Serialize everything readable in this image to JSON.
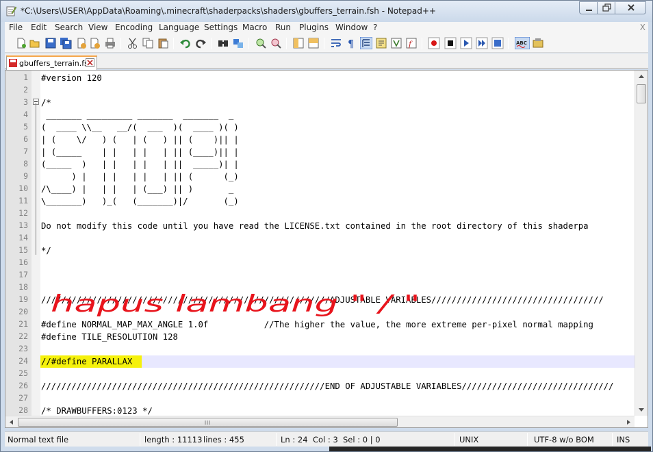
{
  "window": {
    "title": "*C:\\Users\\USER\\AppData\\Roaming\\.minecraft\\shaderpacks\\shaders\\gbuffers_terrain.fsh - Notepad++"
  },
  "menu": {
    "items": [
      "File",
      "Edit",
      "Search",
      "View",
      "Encoding",
      "Language",
      "Settings",
      "Macro",
      "Run",
      "Plugins",
      "Window",
      "?"
    ],
    "close_label": "X"
  },
  "toolbar": {
    "icons": [
      "new-file-icon",
      "open-file-icon",
      "save-icon",
      "save-all-icon",
      "close-icon",
      "close-all-icon",
      "print-icon",
      "cut-icon",
      "copy-icon",
      "paste-icon",
      "undo-icon",
      "redo-icon",
      "find-icon",
      "replace-icon",
      "zoom-in-icon",
      "zoom-out-icon",
      "sync-vertical-icon",
      "sync-horizontal-icon",
      "word-wrap-icon",
      "show-all-chars-icon",
      "indent-guide-icon",
      "user-language-icon",
      "document-map-icon",
      "function-list-icon",
      "record-macro-icon",
      "stop-macro-icon",
      "play-macro-icon",
      "run-macro-multiple-icon",
      "save-macro-icon",
      "spellcheck-icon",
      "plugin-icon"
    ]
  },
  "tab": {
    "label": "gbuffers_terrain.fsh"
  },
  "editor": {
    "line_numbers": [
      "1",
      "2",
      "3",
      "4",
      "5",
      "6",
      "7",
      "8",
      "9",
      "10",
      "11",
      "12",
      "13",
      "14",
      "15",
      "16",
      "17",
      "18",
      "19",
      "20",
      "21",
      "22",
      "23",
      "24",
      "25",
      "26",
      "27",
      "28"
    ],
    "lines": [
      "#version 120",
      "",
      "/*",
      " _______ _________ _______  _______  _",
      "(  ____ \\\\__   __/(  ___  )(  ____ )( )",
      "| (    \\/   ) (   | (   ) || (    )|| |",
      "| (_____    | |   | |   | || (____)|| |",
      "(_____  )   | |   | |   | ||  _____)| |",
      "      ) |   | |   | |   | || (      (_)",
      "/\\____) |   | |   | (___) || )       _",
      "\\_______)   )_(   (_______)|/       (_)",
      "",
      "Do not modify this code until you have read the LICENSE.txt contained in the root directory of this shaderpa",
      "",
      "*/",
      "",
      "",
      "",
      "/////////////////////////////////////////////////////////ADJUSTABLE VARIABLES//////////////////////////////////",
      "",
      "#define NORMAL_MAP_MAX_ANGLE 1.0f           //The higher the value, the more extreme per-pixel normal mapping",
      "#define TILE_RESOLUTION 128",
      "",
      "//#define PARALLAX",
      "",
      "////////////////////////////////////////////////////////END OF ADJUSTABLE VARIABLES//////////////////////////////",
      "",
      "/* DRAWBUFFERS:0123 */"
    ],
    "current_line": 24,
    "highlight_color": "#f5f10c",
    "current_line_color": "#e8e8ff"
  },
  "annotation": {
    "text": "hapus lambang \" / \"",
    "color": "#e8141c"
  },
  "status": {
    "file_type": "Normal text file",
    "length": "length : 11113",
    "lines": "lines : 455",
    "ln": "Ln : 24",
    "col": "Col : 3",
    "sel": "Sel : 0 | 0",
    "eol": "UNIX",
    "encoding": "UTF-8 w/o BOM",
    "mode": "INS"
  }
}
